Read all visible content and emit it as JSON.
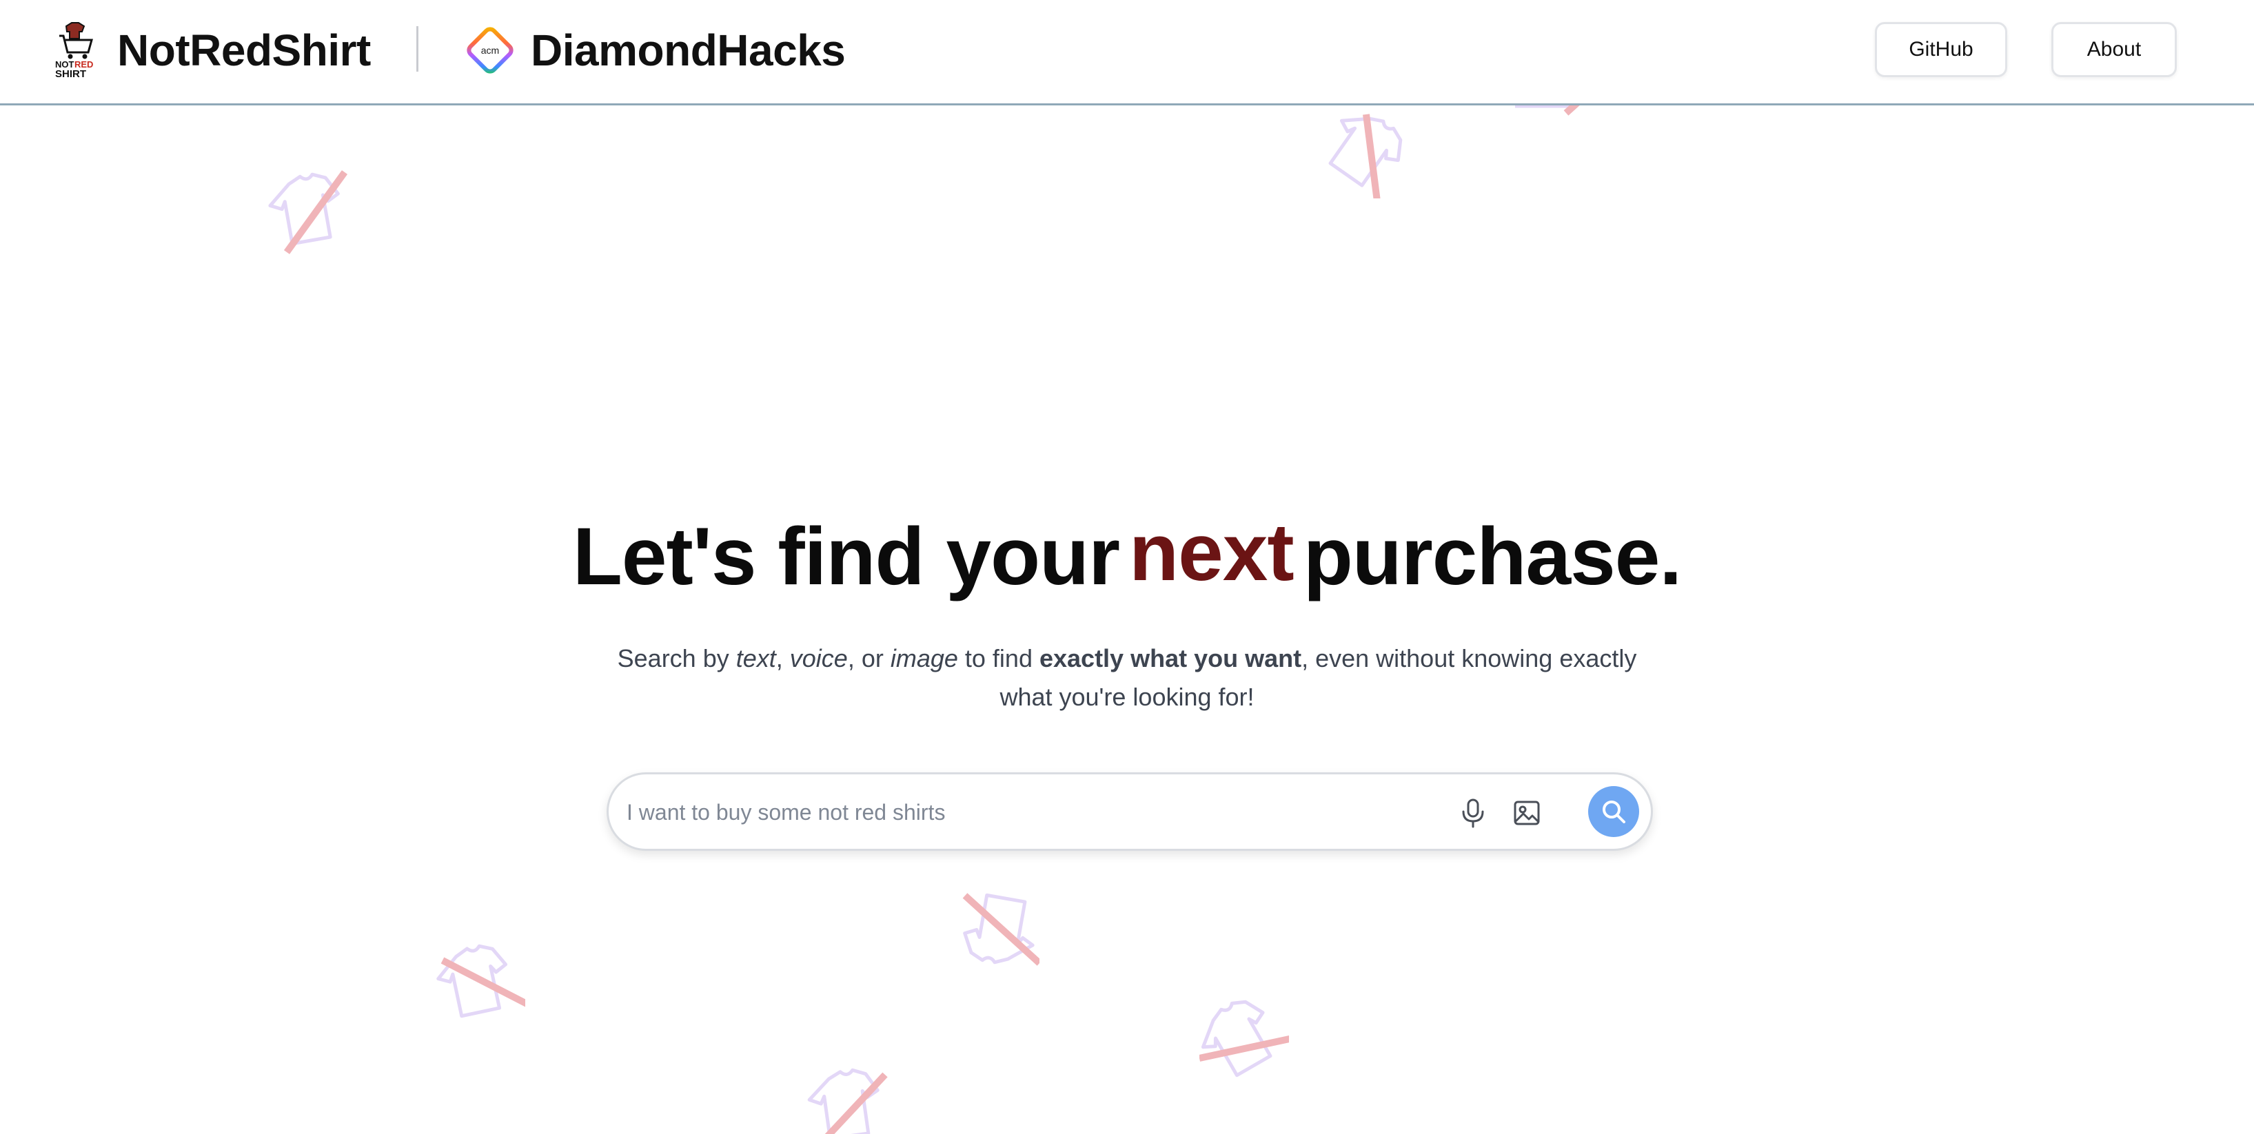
{
  "header": {
    "brand_name": "NotRedShirt",
    "brand_logo_text": [
      "NOT",
      "RED",
      "SHIRT"
    ],
    "partner_name": "DiamondHacks",
    "partner_logo_text": "acm",
    "nav": {
      "github_label": "GitHub",
      "about_label": "About"
    }
  },
  "hero": {
    "headline_before": "Let's find your",
    "headline_accent": "next",
    "headline_after": "purchase.",
    "subtitle": {
      "p1": "Search by ",
      "text": "text",
      "p2": ", ",
      "voice": "voice",
      "p3": ", or ",
      "image": "image",
      "p4": " to find ",
      "bold": "exactly what you want",
      "p5": ", even without knowing exactly what you're looking for!"
    }
  },
  "search": {
    "placeholder": "I want to buy some not red shirts",
    "value": ""
  },
  "icons": {
    "mic": "microphone-icon",
    "image": "image-icon",
    "search": "search-icon",
    "shirt": "crossed-out-shirt-icon"
  },
  "colors": {
    "accent": "#6b1414",
    "search_button": "#6fa7f2",
    "header_border": "#8fa8b8",
    "shirt_outline": "#e3d7f7",
    "shirt_slash": "#f0b4b8"
  }
}
